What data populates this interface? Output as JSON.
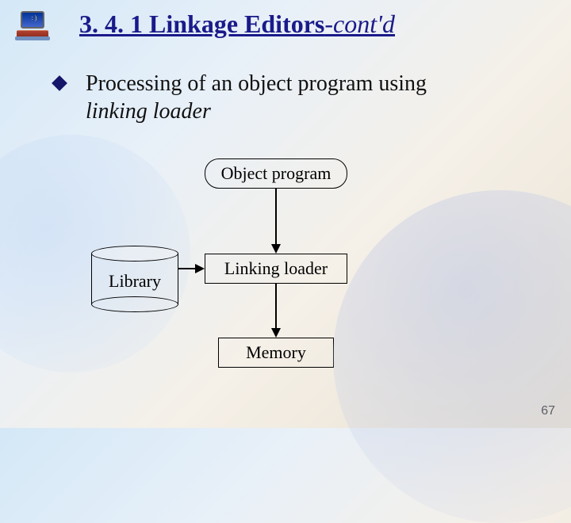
{
  "title": {
    "section_number": "3. 4. 1",
    "main": "Linkage Editors",
    "suffix": "-cont'd"
  },
  "bullet": {
    "lead": "Processing of an object program using",
    "emphasis": "linking loader"
  },
  "diagram": {
    "object_program": "Object program",
    "linking_loader": "Linking loader",
    "memory": "Memory",
    "library": "Library"
  },
  "page_number": "67",
  "chart_data": {
    "type": "flow-diagram",
    "nodes": [
      {
        "id": "object_program",
        "label": "Object program",
        "shape": "rounded-rect"
      },
      {
        "id": "library",
        "label": "Library",
        "shape": "cylinder"
      },
      {
        "id": "linking_loader",
        "label": "Linking loader",
        "shape": "rect"
      },
      {
        "id": "memory",
        "label": "Memory",
        "shape": "rect"
      }
    ],
    "edges": [
      {
        "from": "object_program",
        "to": "linking_loader"
      },
      {
        "from": "library",
        "to": "linking_loader"
      },
      {
        "from": "linking_loader",
        "to": "memory"
      }
    ]
  }
}
